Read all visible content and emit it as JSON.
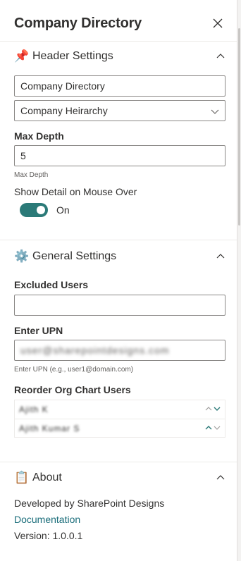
{
  "panel": {
    "title": "Company Directory",
    "close_icon": "close-icon"
  },
  "header_settings": {
    "icon": "pushpin-icon",
    "emoji": "📌",
    "title": "Header Settings",
    "title_value": "Company Directory",
    "view_selected": "Company Heirarchy",
    "max_depth_label": "Max Depth",
    "max_depth_value": "5",
    "max_depth_helper": "Max Depth",
    "hover_label": "Show Detail on Mouse Over",
    "hover_toggle_state": "On",
    "hover_enabled": true
  },
  "general_settings": {
    "icon": "gear-icon",
    "emoji": "⚙️",
    "title": "General Settings",
    "excluded_label": "Excluded Users",
    "excluded_value": "",
    "upn_label": "Enter UPN",
    "upn_value": "user@sharepointdesigns.com",
    "upn_helper": "Enter UPN (e.g., user1@domain.com)",
    "reorder_label": "Reorder Org Chart Users",
    "reorder_users": [
      {
        "name": "Ajith K"
      },
      {
        "name": "Ajith Kumar S"
      }
    ]
  },
  "about": {
    "icon": "clipboard-icon",
    "emoji": "📋",
    "title": "About",
    "developed_by": "Developed by SharePoint Designs",
    "documentation_link": "Documentation",
    "version": "Version: 1.0.0.1"
  },
  "colors": {
    "accent": "#2b7a78",
    "link": "#1a6d7a",
    "text": "#323130",
    "border": "#8a8886"
  }
}
